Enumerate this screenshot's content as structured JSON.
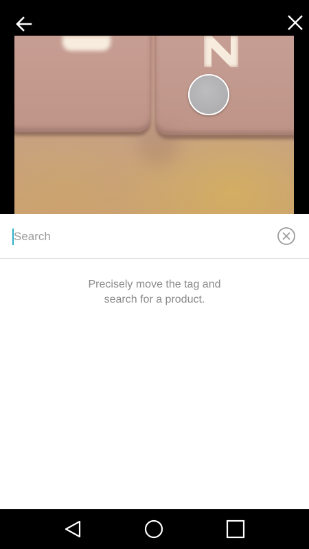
{
  "header": {
    "back_icon": "arrow-left-icon",
    "close_icon": "close-icon"
  },
  "search": {
    "placeholder": "Search",
    "value": "",
    "clear_icon": "clear-circle-icon",
    "cursor_color": "#2ab0c8"
  },
  "hint": {
    "line1": "Precisely move the tag and",
    "line2": "search for a product."
  },
  "navigation": {
    "back_icon": "triangle-back-icon",
    "home_icon": "circle-home-icon",
    "recents_icon": "square-recents-icon"
  },
  "colors": {
    "top_background": "#000000",
    "nav_background": "#000000",
    "hint_text": "#8a8a8a"
  }
}
